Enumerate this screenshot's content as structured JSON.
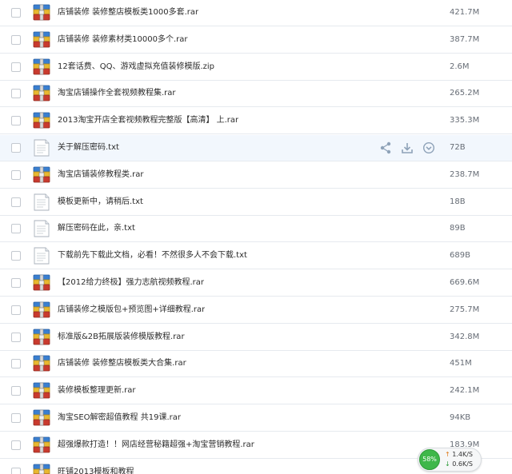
{
  "files": [
    {
      "name": "店铺装修 装修整店模板类1000多套.rar",
      "size": "421.7M",
      "type": "archive"
    },
    {
      "name": "店铺装修 装修素材类10000多个.rar",
      "size": "387.7M",
      "type": "archive"
    },
    {
      "name": "12套话费、QQ、游戏虚拟充值装修模版.zip",
      "size": "2.6M",
      "type": "archive"
    },
    {
      "name": "淘宝店铺操作全套视频教程集.rar",
      "size": "265.2M",
      "type": "archive"
    },
    {
      "name": "2013淘宝开店全套视频教程完整版【高清】 上.rar",
      "size": "335.3M",
      "type": "archive"
    },
    {
      "name": "关于解压密码.txt",
      "size": "72B",
      "type": "text",
      "hovered": true
    },
    {
      "name": "淘宝店铺装修教程类.rar",
      "size": "238.7M",
      "type": "archive"
    },
    {
      "name": "模板更新中，请稍后.txt",
      "size": "18B",
      "type": "text"
    },
    {
      "name": "解压密码在此，亲.txt",
      "size": "89B",
      "type": "text"
    },
    {
      "name": "下载前先下载此文档，必看！不然很多人不会下载.txt",
      "size": "689B",
      "type": "text"
    },
    {
      "name": "【2012给力终极】强力志航视频教程.rar",
      "size": "669.6M",
      "type": "archive"
    },
    {
      "name": "店铺装修之模版包+预览图+详细教程.rar",
      "size": "275.7M",
      "type": "archive"
    },
    {
      "name": "标准版&2B拓展版装修模版教程.rar",
      "size": "342.8M",
      "type": "archive"
    },
    {
      "name": "店铺装修 装修整店模板类大合集.rar",
      "size": "451M",
      "type": "archive"
    },
    {
      "name": "装修模板整理更新.rar",
      "size": "242.1M",
      "type": "archive"
    },
    {
      "name": "淘宝SEO解密超值教程 共19课.rar",
      "size": "94KB",
      "type": "archive"
    },
    {
      "name": "超强爆款打造！！网店经营秘籍超强+淘宝营销教程.rar",
      "size": "183.9M",
      "type": "archive"
    },
    {
      "name": "旺铺2013模板和教程",
      "size": "",
      "type": "archive"
    }
  ],
  "speed_widget": {
    "percent": "58%",
    "upload": "1.4K/S",
    "download": "0.6K/S",
    "up_arrow": "↑",
    "down_arrow": "↓"
  },
  "icons": {
    "archive": "archive-file-icon",
    "text": "text-file-icon",
    "share": "share-icon",
    "download": "download-icon",
    "more": "chevron-down-circle-icon"
  },
  "colors": {
    "hover_row": "#f2f7fd",
    "badge_green": "#3fb74a",
    "action_icon": "#8ea2b8"
  }
}
